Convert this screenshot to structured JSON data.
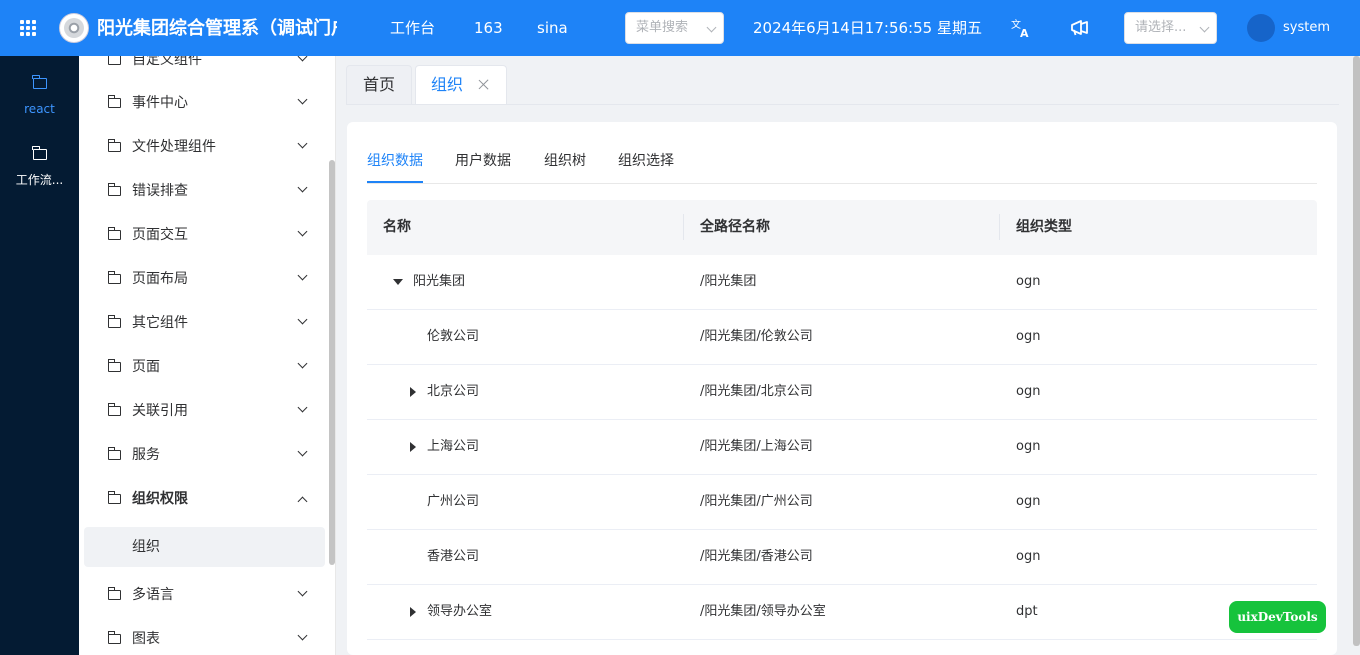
{
  "header": {
    "title": "阳光集团综合管理系（调试门户）",
    "nav": [
      "工作台",
      "163",
      "sina"
    ],
    "menu_search_placeholder": "菜单搜索",
    "datetime": "2024年6月14日17:56:55 星期五",
    "select_placeholder": "请选择...",
    "username": "system",
    "icons": [
      "apps-grid-icon",
      "translate-icon",
      "announcement-icon"
    ]
  },
  "rail": [
    {
      "label": "react",
      "active": true
    },
    {
      "label": "工作流...",
      "active": false
    }
  ],
  "menu": {
    "items": [
      "自定义组件",
      "事件中心",
      "文件处理组件",
      "错误排查",
      "页面交互",
      "页面布局",
      "其它组件",
      "页面",
      "关联引用",
      "服务",
      "组织权限",
      "多语言",
      "图表"
    ],
    "open_item": "组织权限",
    "sub_item": "组织"
  },
  "tabs": [
    {
      "label": "首页",
      "active": false
    },
    {
      "label": "组织",
      "active": true,
      "closable": true
    }
  ],
  "subtabs": [
    "组织数据",
    "用户数据",
    "组织树",
    "组织选择"
  ],
  "table": {
    "columns": [
      "名称",
      "全路径名称",
      "组织类型"
    ],
    "rows": [
      {
        "name": "阳光集团",
        "path": "/阳光集团",
        "type": "ogn",
        "level": 0,
        "expander": "expanded"
      },
      {
        "name": "伦敦公司",
        "path": "/阳光集团/伦敦公司",
        "type": "ogn",
        "level": 1,
        "expander": "none"
      },
      {
        "name": "北京公司",
        "path": "/阳光集团/北京公司",
        "type": "ogn",
        "level": 1,
        "expander": "collapsed"
      },
      {
        "name": "上海公司",
        "path": "/阳光集团/上海公司",
        "type": "ogn",
        "level": 1,
        "expander": "collapsed"
      },
      {
        "name": "广州公司",
        "path": "/阳光集团/广州公司",
        "type": "ogn",
        "level": 1,
        "expander": "none"
      },
      {
        "name": "香港公司",
        "path": "/阳光集团/香港公司",
        "type": "ogn",
        "level": 1,
        "expander": "none"
      },
      {
        "name": "领导办公室",
        "path": "/阳光集团/领导办公室",
        "type": "dpt",
        "level": 1,
        "expander": "collapsed"
      }
    ]
  },
  "devtools_label": "uixDevTools",
  "colors": {
    "primary": "#1e83f7",
    "rail_bg": "#041b33",
    "devtools": "#16c33c"
  }
}
